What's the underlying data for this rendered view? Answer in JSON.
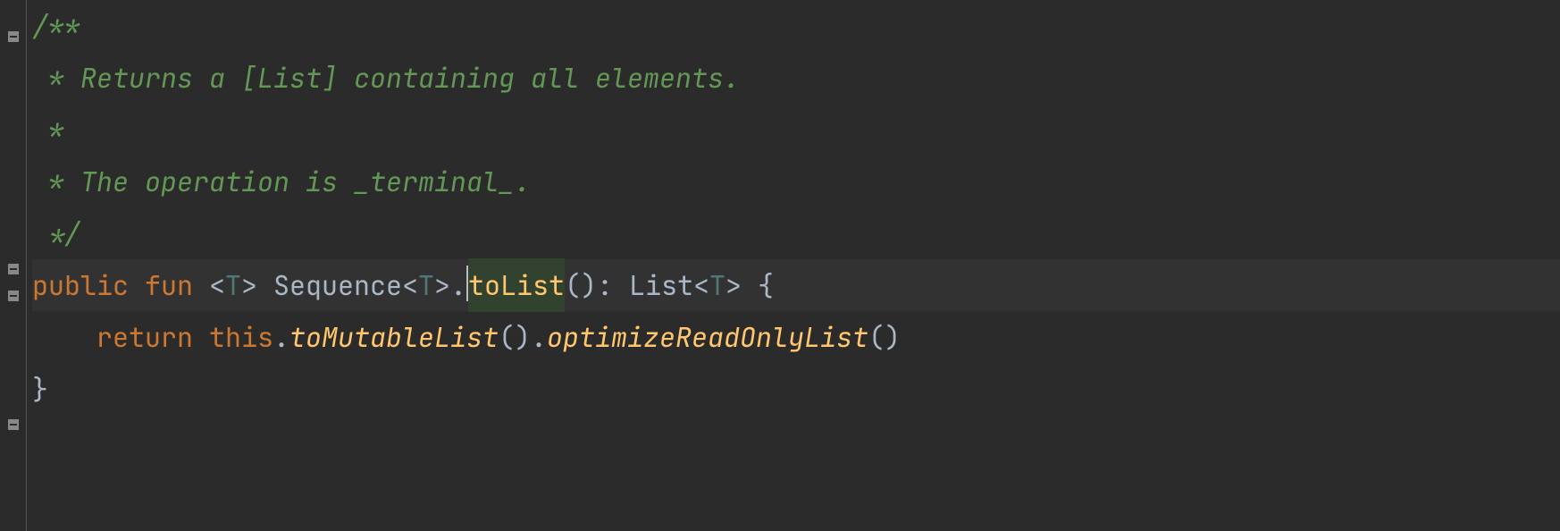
{
  "code": {
    "lines": [
      {
        "segments": [
          {
            "text": "/**",
            "class": "comment"
          }
        ]
      },
      {
        "segments": [
          {
            "text": " * Returns a ",
            "class": "comment"
          },
          {
            "text": "[List]",
            "class": "doc-link"
          },
          {
            "text": " containing all elements.",
            "class": "comment"
          }
        ]
      },
      {
        "segments": [
          {
            "text": " *",
            "class": "comment"
          }
        ]
      },
      {
        "segments": [
          {
            "text": " * The operation is _terminal_.",
            "class": "comment"
          }
        ]
      },
      {
        "segments": [
          {
            "text": " */",
            "class": "comment"
          }
        ]
      },
      {
        "highlighted": true,
        "segments": [
          {
            "text": "public ",
            "class": "keyword"
          },
          {
            "text": "fun ",
            "class": "keyword"
          },
          {
            "text": "<",
            "class": "punct"
          },
          {
            "text": "T",
            "class": "type-param"
          },
          {
            "text": "> ",
            "class": "punct"
          },
          {
            "text": "Sequence",
            "class": "type-name"
          },
          {
            "text": "<",
            "class": "punct"
          },
          {
            "text": "T",
            "class": "type-param"
          },
          {
            "text": ">.",
            "class": "punct"
          },
          {
            "caret": true
          },
          {
            "text": "toList",
            "class": "func-name",
            "caretHighlight": true
          },
          {
            "text": "(): ",
            "class": "punct"
          },
          {
            "text": "List",
            "class": "type-name"
          },
          {
            "text": "<",
            "class": "punct"
          },
          {
            "text": "T",
            "class": "type-param"
          },
          {
            "text": "> {",
            "class": "punct"
          }
        ]
      },
      {
        "segments": [
          {
            "text": "    ",
            "class": "punct"
          },
          {
            "text": "return ",
            "class": "keyword"
          },
          {
            "text": "this",
            "class": "this-kw"
          },
          {
            "text": ".",
            "class": "punct"
          },
          {
            "text": "toMutableList",
            "class": "func-call"
          },
          {
            "text": "().",
            "class": "punct"
          },
          {
            "text": "optimizeReadOnlyList",
            "class": "func-call"
          },
          {
            "text": "()",
            "class": "punct"
          }
        ]
      },
      {
        "segments": [
          {
            "text": "}",
            "class": "punct"
          }
        ]
      }
    ],
    "fold_markers": [
      {
        "line": 0,
        "type": "open-down"
      },
      {
        "line": 4,
        "type": "close-up"
      },
      {
        "line": 5,
        "type": "open-down"
      },
      {
        "line": 7,
        "type": "close-up"
      }
    ]
  }
}
